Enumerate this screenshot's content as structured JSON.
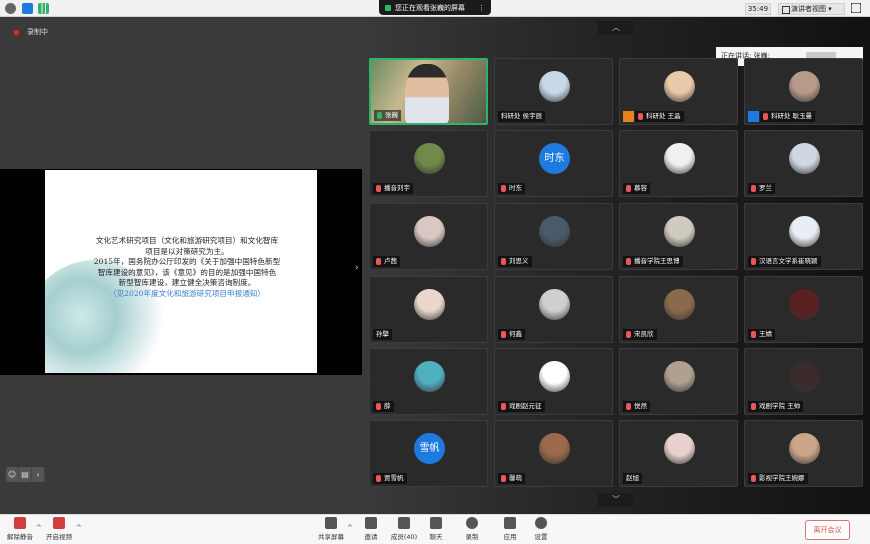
{
  "topbar": {
    "share_status": "您正在观看张巍的屏幕",
    "timer": "35:49",
    "view_button": "演讲者视图"
  },
  "recording": {
    "label": "录制中"
  },
  "slide": {
    "lines": [
      "文化艺术研究项目（文化和旅游研究项目）和文化智库",
      "项目是以对策研究为主。",
      "2015年，国务院办公厅印发的《关于加强中国特色新型",
      "智库建设的意见》，该《意见》的目的是加强中国特色",
      "新型智库建设，建立健全决策咨询制度。"
    ],
    "link": "（见2020年度文化和旅游研究项目申报通知）"
  },
  "speaking": {
    "label": "正在讲话: 张巍;"
  },
  "participants": [
    {
      "name": "张巍",
      "type": "video",
      "mic": "on"
    },
    {
      "name": "科研处 侯宇辰",
      "type": "avatar",
      "color": "#c8d8e8",
      "mic": "none"
    },
    {
      "name": "科研处 王晶",
      "type": "avatar",
      "color": "#e9c9a8",
      "mic": "muted",
      "badge": "orange"
    },
    {
      "name": "科研处 耿玉曼",
      "type": "avatar",
      "color": "#b89a88",
      "mic": "muted",
      "badge": "blue"
    },
    {
      "name": "播音刘宇",
      "type": "avatar",
      "color": "#6f8a4a",
      "mic": "muted"
    },
    {
      "name": "时东",
      "type": "text",
      "initials": "时东",
      "mic": "muted"
    },
    {
      "name": "慕容",
      "type": "avatar",
      "color": "#f0f0f0",
      "mic": "muted"
    },
    {
      "name": "罗兰",
      "type": "avatar",
      "color": "#cfd8e2",
      "mic": "muted"
    },
    {
      "name": "卢茜",
      "type": "avatar",
      "color": "#d8c7c2",
      "mic": "muted"
    },
    {
      "name": "刘思义",
      "type": "avatar",
      "color": "#4a5a6a",
      "mic": "muted"
    },
    {
      "name": "播音学院王思博",
      "type": "avatar",
      "color": "#d0cbc0",
      "mic": "muted"
    },
    {
      "name": "汉语言文学系崔晓颖",
      "type": "avatar",
      "color": "#e8eef4",
      "mic": "muted"
    },
    {
      "name": "孙擘",
      "type": "avatar",
      "color": "#ead6cc",
      "mic": "none"
    },
    {
      "name": "何鑫",
      "type": "avatar",
      "color": "#cfcfcf",
      "mic": "muted"
    },
    {
      "name": "宋凯欣",
      "type": "avatar",
      "color": "#8a6a4a",
      "mic": "muted"
    },
    {
      "name": "王婧",
      "type": "avatar",
      "color": "#5a2020",
      "mic": "muted"
    },
    {
      "name": "薛",
      "type": "avatar",
      "color": "#4fb0c0",
      "mic": "muted"
    },
    {
      "name": "戏剧赵元征",
      "type": "avatar",
      "color": "#ffffff",
      "mic": "muted"
    },
    {
      "name": "悦然",
      "type": "avatar",
      "color": "#b0a090",
      "mic": "muted"
    },
    {
      "name": "戏剧学院 王帅",
      "type": "avatar",
      "color": "#3a2a2a",
      "mic": "muted"
    },
    {
      "name": "贾雪帆",
      "type": "text",
      "initials": "雪帆",
      "mic": "muted"
    },
    {
      "name": "馨萌",
      "type": "avatar",
      "color": "#9a6a4a",
      "mic": "muted"
    },
    {
      "name": "赵旭",
      "type": "avatar",
      "color": "#e8d0cc",
      "mic": "none"
    },
    {
      "name": "影视学院王婉娜",
      "type": "avatar",
      "color": "#c9a58a",
      "mic": "muted"
    }
  ],
  "toolbar": {
    "mute": "解除静音",
    "video": "开启视频",
    "share": "共享屏幕",
    "invite": "邀请",
    "members": "成员(40)",
    "chat": "聊天",
    "record": "录制",
    "apps": "应用",
    "settings": "设置",
    "leave": "离开会议"
  }
}
